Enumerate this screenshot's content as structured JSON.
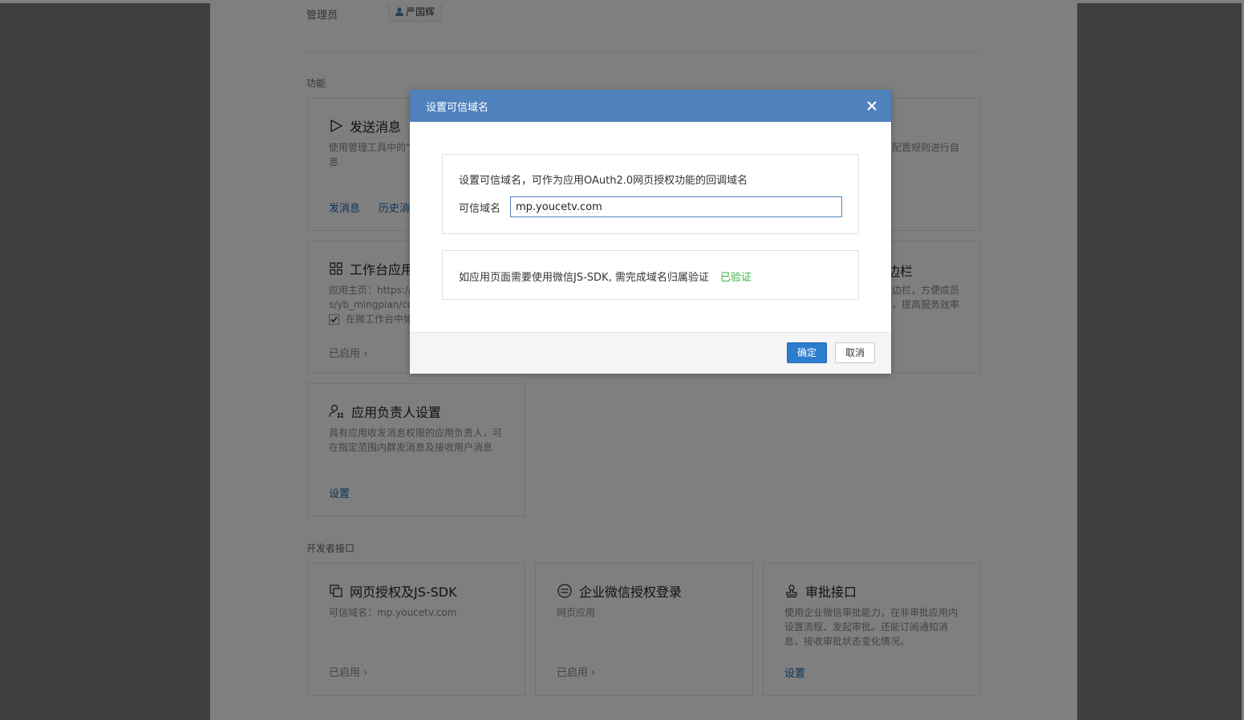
{
  "header": {
    "admin_label": "管理员",
    "admin_name": "严国辉"
  },
  "sections": {
    "features_title": "功能",
    "dev_title": "开发者接口"
  },
  "cards": {
    "send_message": {
      "title": "发送消息",
      "desc_line1": "使用管理工具中的“",
      "desc_line2": "息",
      "link1": "发消息",
      "link2": "历史消",
      "right_desc": "配置规则进行自"
    },
    "workbench": {
      "title": "工作台应用",
      "desc_line1": "应用主页：https://m",
      "desc_line2": "s/yb_mingpian/core",
      "checkbox_label": "在微工作台中如",
      "status": "已启用",
      "right_title": "边栏",
      "right_desc1": "边栏，方便成员",
      "right_desc2": "，提高服务效率"
    },
    "owner": {
      "title": "应用负责人设置",
      "desc_line1": "具有应用收发消息权限的应用负责人，可",
      "desc_line2": "在指定范围内群发消息及接收用户消息",
      "link": "设置"
    },
    "oauth": {
      "title": "网页授权及JS-SDK",
      "desc": "可信域名：mp.youcetv.com",
      "status": "已启用"
    },
    "wecom_login": {
      "title": "企业微信授权登录",
      "desc": "网页应用",
      "status": "已启用"
    },
    "approval": {
      "title": "审批接口",
      "desc_line1": "使用企业微信审批能力，在非审批应用内",
      "desc_line2": "设置流程、发起审批。还能订阅通知消",
      "desc_line3": "息，接收审批状态变化情况。",
      "link": "设置"
    }
  },
  "dialog": {
    "title": "设置可信域名",
    "intro": "设置可信域名，可作为应用OAuth2.0网页授权功能的回调域名",
    "domain_label": "可信域名",
    "domain_value": "mp.youcetv.com",
    "jssdk_note": "如应用页面需要使用微信JS-SDK, 需完成域名归属验证",
    "verified_text": "已验证",
    "confirm_label": "确定",
    "cancel_label": "取消"
  },
  "colors": {
    "dialog_header": "#4f82bd",
    "primary_button": "#2d7dcf",
    "link": "#1a69b6",
    "verified": "#3ab33a"
  }
}
